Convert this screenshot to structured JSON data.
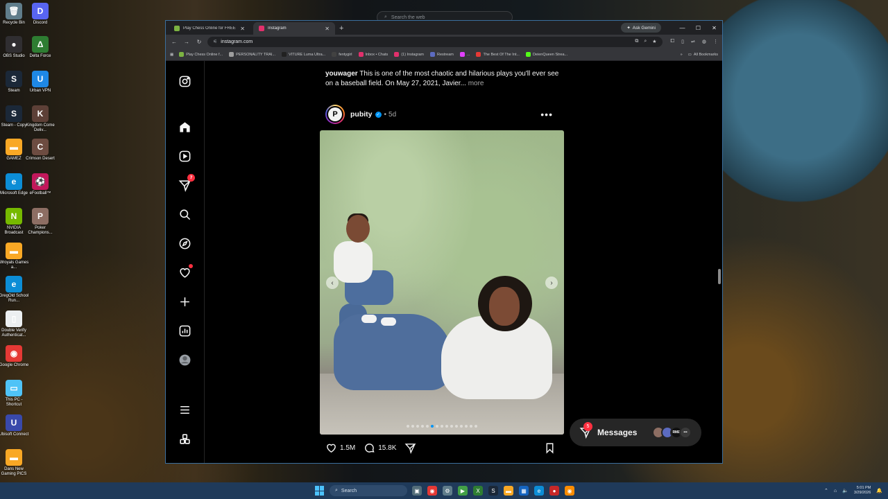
{
  "desktop": {
    "icons": [
      {
        "label": "Recycle Bin",
        "glyph": "🗑",
        "color": "#607d8b"
      },
      {
        "label": "Discord",
        "glyph": "D",
        "color": "#5865f2"
      },
      {
        "label": "OBS Studio",
        "glyph": "●",
        "color": "#302e31"
      },
      {
        "label": "Delta Force",
        "glyph": "Δ",
        "color": "#2e7d32"
      },
      {
        "label": "Steam",
        "glyph": "S",
        "color": "#1b2838"
      },
      {
        "label": "Urban VPN",
        "glyph": "U",
        "color": "#1e88e5"
      },
      {
        "label": "Steam - Copy",
        "glyph": "S",
        "color": "#1b2838"
      },
      {
        "label": "Kingdom Come Deliv...",
        "glyph": "K",
        "color": "#5d4037"
      },
      {
        "label": "GAMEZ",
        "glyph": "▬",
        "color": "#f9a825"
      },
      {
        "label": "Crimson Desert",
        "glyph": "C",
        "color": "#6d4c41"
      },
      {
        "label": "Microsoft Edge",
        "glyph": "e",
        "color": "#0c8dd6"
      },
      {
        "label": "eFootball™",
        "glyph": "⚽",
        "color": "#c2185b"
      },
      {
        "label": "NVIDIA Broadcast",
        "glyph": "N",
        "color": "#76b900"
      },
      {
        "label": "Poker Champions...",
        "glyph": "P",
        "color": "#8d6e63"
      },
      {
        "label": "Wroyals Games a...",
        "glyph": "▬",
        "color": "#f9a825"
      },
      {
        "label": "GregOld School Run...",
        "glyph": "e",
        "color": "#0c8dd6"
      },
      {
        "label": "Double Verify Authenticat...",
        "glyph": "▯",
        "color": "#eceff1"
      },
      {
        "label": "Google Chrome",
        "glyph": "◉",
        "color": "#e53935"
      },
      {
        "label": "This PC - Shortcut",
        "glyph": "▭",
        "color": "#4fc3f7"
      },
      {
        "label": "Ubisoft Connect",
        "glyph": "U",
        "color": "#3949ab"
      },
      {
        "label": "Dans New Gaming PICS",
        "glyph": "▬",
        "color": "#f9a825"
      }
    ],
    "bg_search_placeholder": "Search the web"
  },
  "browser": {
    "tabs": [
      {
        "title": "Play Chess Online for FREE - 2 ...",
        "favicon_color": "#7cb342",
        "active": false
      },
      {
        "title": "Instagram",
        "favicon_color": "#e1306c",
        "active": true
      }
    ],
    "ask_gemini": "Ask Gemini",
    "url": "instagram.com",
    "bookmarks": [
      {
        "label": "Play Chess Online f...",
        "color": "#7cb342"
      },
      {
        "label": "PERSONALITY TRAI...",
        "color": "#9e9e9e"
      },
      {
        "label": "VITURE Luma Ultra...",
        "color": "#212121"
      },
      {
        "label": "fentygirl",
        "color": "#424242"
      },
      {
        "label": "Inbox • Chats",
        "color": "#e1306c"
      },
      {
        "label": "(1) Instagram",
        "color": "#e1306c"
      },
      {
        "label": "Restream",
        "color": "#5c6bc0"
      },
      {
        "label": "...",
        "color": "#e040fb"
      },
      {
        "label": "The Best Of The Int...",
        "color": "#e53935"
      },
      {
        "label": "DeienQueen Strea...",
        "color": "#53fc18"
      }
    ],
    "all_bookmarks": "All Bookmarks"
  },
  "instagram": {
    "nav": [
      {
        "name": "instagram-logo-icon"
      },
      {
        "name": "home-icon"
      },
      {
        "name": "reels-icon"
      },
      {
        "name": "messenger-icon",
        "badge": "7"
      },
      {
        "name": "search-icon"
      },
      {
        "name": "explore-icon"
      },
      {
        "name": "notifications-icon",
        "dot": true
      },
      {
        "name": "create-icon"
      },
      {
        "name": "dashboard-icon"
      },
      {
        "name": "profile-avatar-icon"
      },
      {
        "name": "more-menu-icon"
      },
      {
        "name": "also-from-meta-icon"
      }
    ],
    "caption": {
      "user": "youwager",
      "text": "This is one of the most chaotic and hilarious plays you'll ever see on a baseball field. On May 27, 2021, Javier...",
      "more": "more"
    },
    "post": {
      "user": "pubity",
      "avatar_letter": "P",
      "dot": "•",
      "time": "5d",
      "more": "•••",
      "carousel_total": 15,
      "carousel_index": 5,
      "likes": "1.5M",
      "comments": "15.8K"
    },
    "messages": {
      "label": "Messages",
      "badge": "5",
      "avatars": [
        {
          "label": "",
          "color": "#8d6e63"
        },
        {
          "label": "",
          "color": "#5c6bc0"
        },
        {
          "label": "RME",
          "color": "#111111"
        },
        {
          "label": "•••",
          "color": "#3a3a3a"
        }
      ]
    }
  },
  "taskbar": {
    "search_placeholder": "Search",
    "apps": [
      {
        "name": "task-view-icon",
        "glyph": "▣",
        "color": "#546e7a"
      },
      {
        "name": "chrome-taskbar-icon",
        "glyph": "◉",
        "color": "#e53935"
      },
      {
        "name": "settings-taskbar-icon",
        "glyph": "⚙",
        "color": "#607d8b"
      },
      {
        "name": "media-taskbar-icon",
        "glyph": "▶",
        "color": "#43a047"
      },
      {
        "name": "xbox-taskbar-icon",
        "glyph": "X",
        "color": "#2e7d32"
      },
      {
        "name": "steam-taskbar-icon",
        "glyph": "S",
        "color": "#1b2838"
      },
      {
        "name": "folder-taskbar-icon",
        "glyph": "▬",
        "color": "#f9a825"
      },
      {
        "name": "store-taskbar-icon",
        "glyph": "▦",
        "color": "#1565c0"
      },
      {
        "name": "edge-taskbar-icon",
        "glyph": "e",
        "color": "#0c8dd6"
      },
      {
        "name": "app-taskbar-icon",
        "glyph": "●",
        "color": "#c62828"
      },
      {
        "name": "chrome-active-taskbar-icon",
        "glyph": "◉",
        "color": "#fb8c00"
      }
    ],
    "time": "5:01 PM",
    "date": "3/29/2026"
  }
}
